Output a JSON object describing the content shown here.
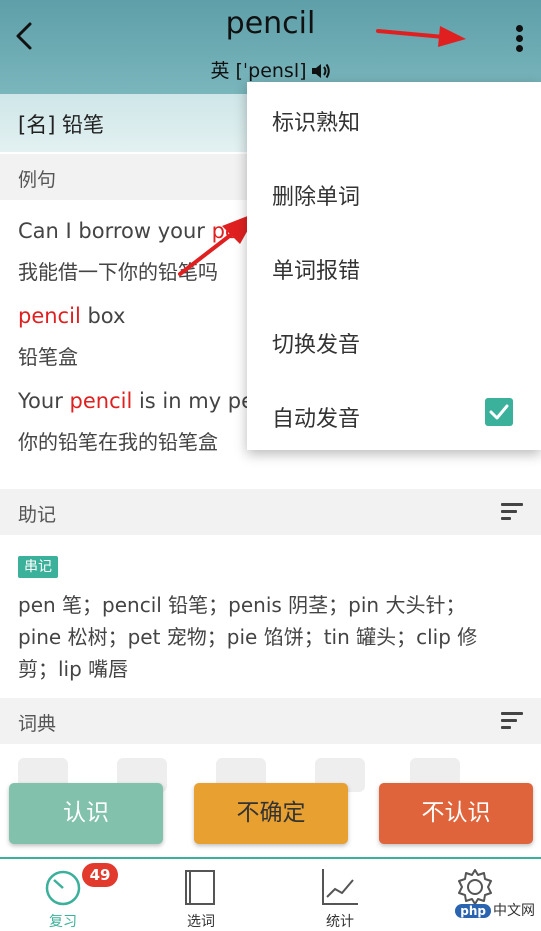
{
  "header": {
    "title": "pencil",
    "phonetic": "英 [ˈpensl]",
    "back_icon": "back-chevron-icon",
    "more_icon": "more-vert-icon"
  },
  "definition": "[名] 铅笔",
  "examples_section": {
    "title": "例句"
  },
  "examples": [
    {
      "pre": "Can I borrow your ",
      "word": "pe",
      "post": "",
      "zh": "我能借一下你的铅笔吗"
    },
    {
      "pre": "",
      "word": "pencil",
      "post": " box",
      "zh": "铅笔盒"
    },
    {
      "pre": "Your ",
      "word": "pencil",
      "post": " is in my pe",
      "zh": "你的铅笔在我的铅笔盒"
    }
  ],
  "mnemonic_section": {
    "title": "助记",
    "tag": "串记"
  },
  "mnemonic_lines": [
    "pen 笔；pencil 铅笔；penis 阴茎；pin 大头针；",
    "pine 松树；pet 宠物；pie 馅饼；tin 罐头；clip 修",
    "剪；lip 嘴唇"
  ],
  "dictionary_section": {
    "title": "词典"
  },
  "buttons": {
    "know": "认识",
    "unsure": "不确定",
    "unknown": "不认识"
  },
  "menu": {
    "items": [
      "标识熟知",
      "删除单词",
      "单词报错",
      "切换发音",
      "自动发音"
    ],
    "auto_pronounce_checked": true
  },
  "tabs": [
    {
      "label": "复习",
      "badge": "49",
      "active": true
    },
    {
      "label": "选词"
    },
    {
      "label": "统计"
    },
    {
      "label": "设置"
    }
  ],
  "watermark": {
    "badge": "php",
    "text": "中文网"
  },
  "colors": {
    "accent": "#3bb09a",
    "highlight": "#e02020",
    "header": "#6aaab2"
  }
}
